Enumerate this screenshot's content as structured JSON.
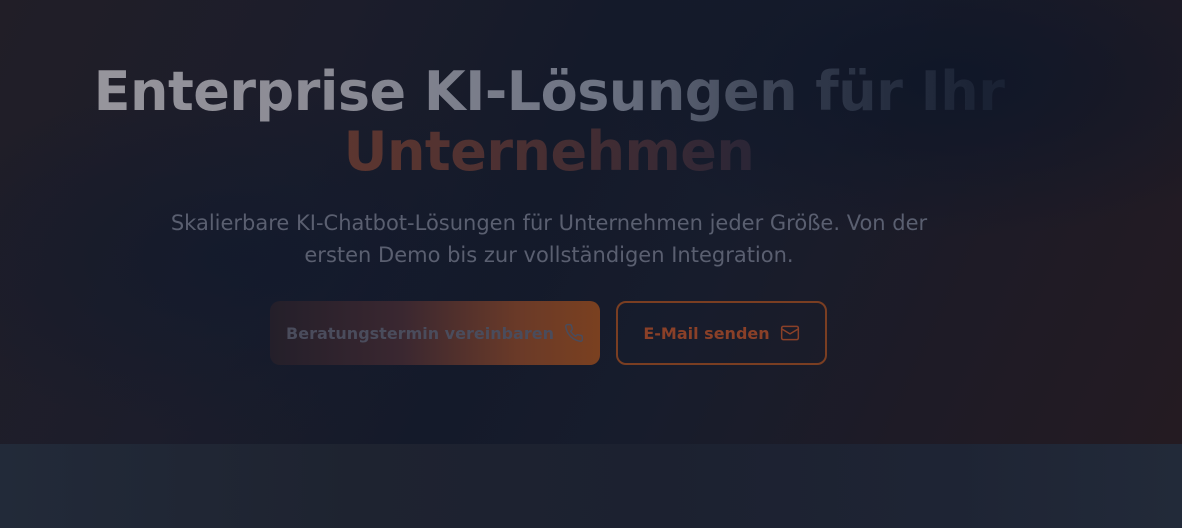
{
  "hero": {
    "headline_line1": "Enterprise KI-Lösungen für Ihr",
    "headline_line2": "Unternehmen",
    "subtitle": "Skalierbare KI-Chatbot-Lösungen für Unternehmen jeder Größe. Von der ersten Demo bis zur vollständigen Integration.",
    "primary_button": {
      "label": "Beratungstermin vereinbaren",
      "icon": "phone-icon"
    },
    "secondary_button": {
      "label": "E-Mail senden",
      "icon": "mail-icon"
    }
  },
  "colors": {
    "accent": "#7a3e22",
    "background": "#1a1d29"
  }
}
